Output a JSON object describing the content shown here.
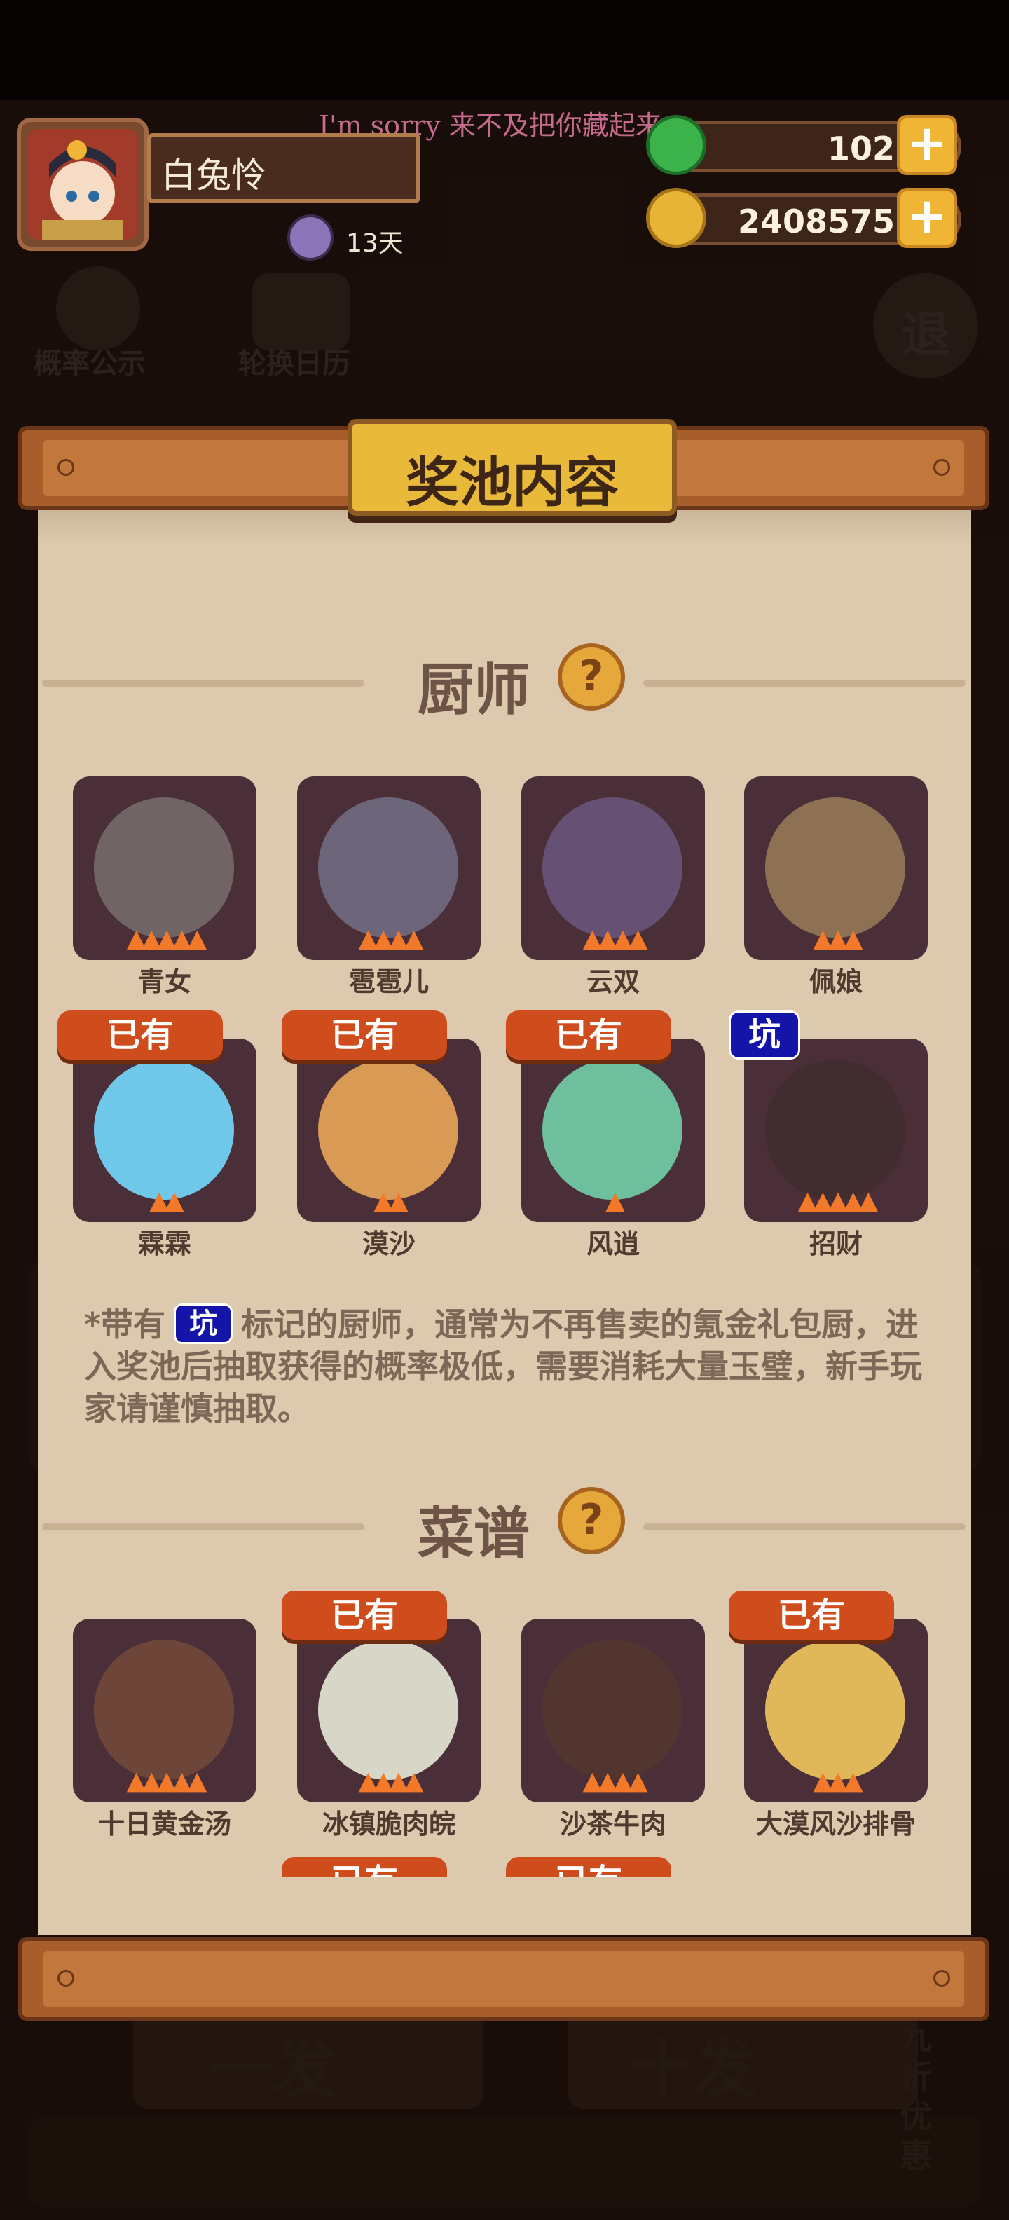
{
  "marquee_text": "I'm sorry 来不及把你藏起来",
  "player": {
    "name": "白兔怜",
    "days": "13天"
  },
  "currency": {
    "jade": "102",
    "coins": "2408575"
  },
  "background": {
    "btn_probability": "概率公示",
    "btn_calendar": "轮换日历",
    "btn_exit": "退",
    "btn_once": "一发",
    "btn_ten": "十发",
    "discount": "九折优惠"
  },
  "panel_title": "奖池内容",
  "chefs": {
    "title": "厨师",
    "help": "?",
    "items": [
      {
        "name": "青女",
        "stars": 5,
        "owned": false,
        "pit": false
      },
      {
        "name": "雹雹儿",
        "stars": 4,
        "owned": false,
        "pit": false
      },
      {
        "name": "云双",
        "stars": 4,
        "owned": false,
        "pit": false
      },
      {
        "name": "佩娘",
        "stars": 3,
        "owned": false,
        "pit": false
      },
      {
        "name": "霖霖",
        "stars": 2,
        "owned": true,
        "pit": false
      },
      {
        "name": "漠沙",
        "stars": 2,
        "owned": true,
        "pit": false
      },
      {
        "name": "风逍",
        "stars": 1,
        "owned": true,
        "pit": false
      },
      {
        "name": "招财",
        "stars": 5,
        "owned": false,
        "pit": true
      }
    ],
    "owned_label": "已有",
    "pit_label": "坑",
    "note_before": "*带有",
    "note_after": "标记的厨师，通常为不再售卖的氪金礼包厨，进入奖池后抽取获得的概率极低，需要消耗大量玉璧，新手玩家请谨慎抽取。"
  },
  "recipes": {
    "title": "菜谱",
    "help": "?",
    "items": [
      {
        "name": "十日黄金汤",
        "stars": 5,
        "owned": false
      },
      {
        "name": "冰镇脆肉皖",
        "stars": 4,
        "owned": true
      },
      {
        "name": "沙茶牛肉",
        "stars": 4,
        "owned": false
      },
      {
        "name": "大漠风沙排骨",
        "stars": 3,
        "owned": true
      }
    ]
  },
  "colors": {
    "owned_badge": "#cf4d1d",
    "pit_badge": "#1414a8",
    "parchment": "#ddc9ad",
    "title_plaque": "#e9b93a"
  }
}
